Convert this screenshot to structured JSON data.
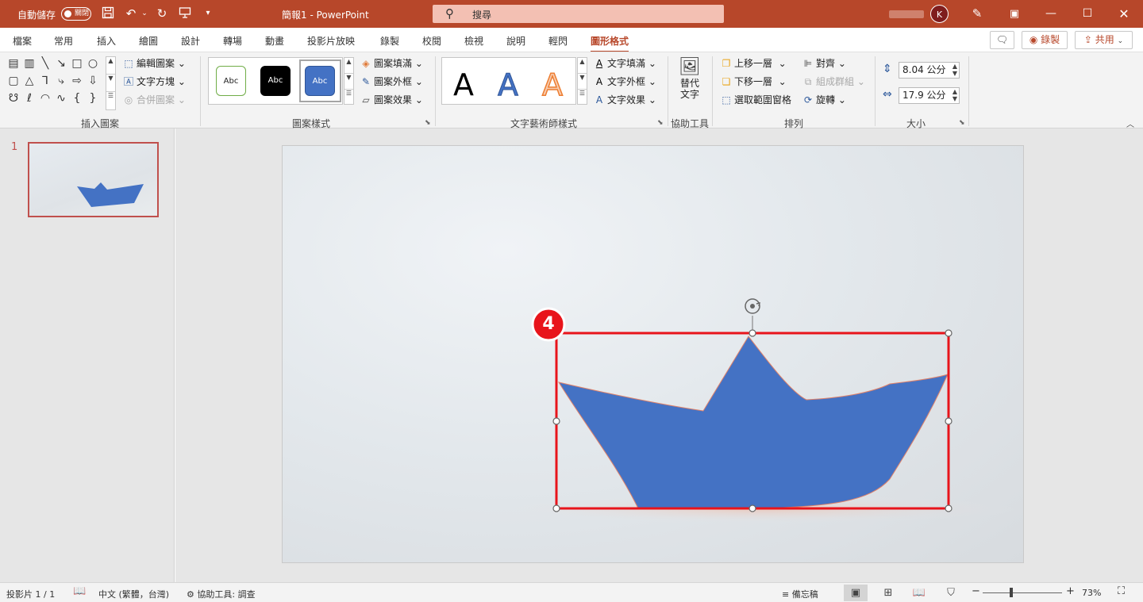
{
  "titlebar": {
    "autosave_label": "自動儲存",
    "autosave_state": "關閉",
    "doc_title": "簡報1  -  PowerPoint",
    "search_placeholder": "搜尋",
    "avatar_initial": "K"
  },
  "tabs": [
    "檔案",
    "常用",
    "插入",
    "繪圖",
    "設計",
    "轉場",
    "動畫",
    "投影片放映",
    "錄製",
    "校閱",
    "檢視",
    "說明",
    "輕閃",
    "圖形格式"
  ],
  "active_tab": "圖形格式",
  "right_buttons": {
    "record": "錄製",
    "share": "共用"
  },
  "ribbon": {
    "insert_shapes": {
      "label": "插入圖案",
      "edit_shape": "編輯圖案",
      "text_box": "文字方塊",
      "merge_shapes": "合併圖案"
    },
    "shape_styles": {
      "label": "圖案樣式",
      "preset": [
        "Abc",
        "Abc",
        "Abc"
      ],
      "fill": "圖案填滿",
      "outline": "圖案外框",
      "effects": "圖案效果"
    },
    "wordart": {
      "label": "文字藝術師樣式",
      "letters": [
        "A",
        "A",
        "A"
      ],
      "text_fill": "文字填滿",
      "text_outline": "文字外框",
      "text_effects": "文字效果"
    },
    "accessibility": {
      "label": "協助工具",
      "alt_text_line1": "替代",
      "alt_text_line2": "文字"
    },
    "arrange": {
      "label": "排列",
      "bring_forward": "上移一層",
      "send_backward": "下移一層",
      "selection_pane": "選取範圍窗格",
      "align": "對齊",
      "group": "組成群組",
      "rotate": "旋轉"
    },
    "size": {
      "label": "大小",
      "height": "8.04 公分",
      "width": "17.9 公分"
    }
  },
  "thumbnail": {
    "number": "1"
  },
  "callout": {
    "number": "4"
  },
  "colors": {
    "accent": "#b7472a",
    "shape_fill": "#4472c4",
    "selection_highlight": "#e8141b"
  },
  "statusbar": {
    "slide_info": "投影片 1 / 1",
    "language": "中文 (繁體，台灣)",
    "accessibility": "協助工具: 調查",
    "notes": "備忘稿",
    "zoom": "73%"
  }
}
